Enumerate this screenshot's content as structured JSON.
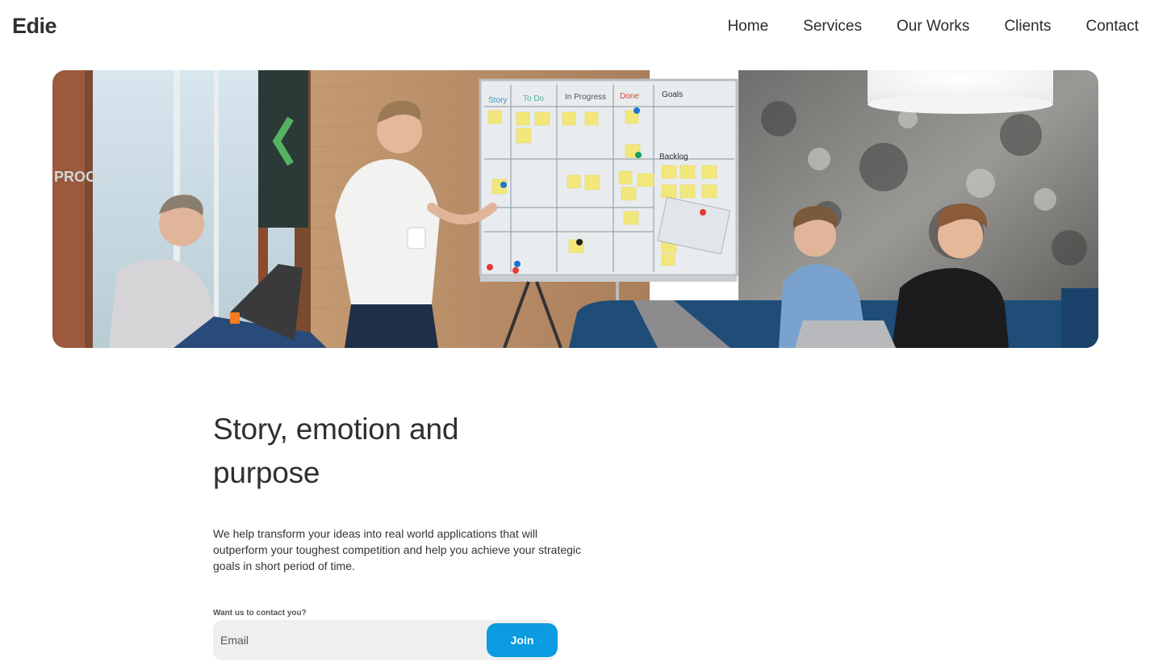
{
  "brand": {
    "name": "Edie"
  },
  "nav": {
    "items": [
      {
        "label": "Home"
      },
      {
        "label": "Services"
      },
      {
        "label": "Our Works"
      },
      {
        "label": "Clients"
      },
      {
        "label": "Contact"
      }
    ]
  },
  "hero": {
    "board_columns": [
      "Story",
      "To Do",
      "In Progress",
      "Done",
      "Goals"
    ],
    "board_section": "Backlog",
    "wall_text": "PROOF"
  },
  "main": {
    "headline_line1": "Story, emotion and",
    "headline_line2": "purpose",
    "description": "We help transform your ideas into real world applications that will outperform your toughest competition and help you achieve your strategic goals in short period of time.",
    "form_label": "Want us to contact you?",
    "email_placeholder": "Email",
    "join_label": "Join"
  },
  "colors": {
    "accent": "#0a9be0",
    "text": "#2f2f2f",
    "input_bg": "#efefef"
  }
}
